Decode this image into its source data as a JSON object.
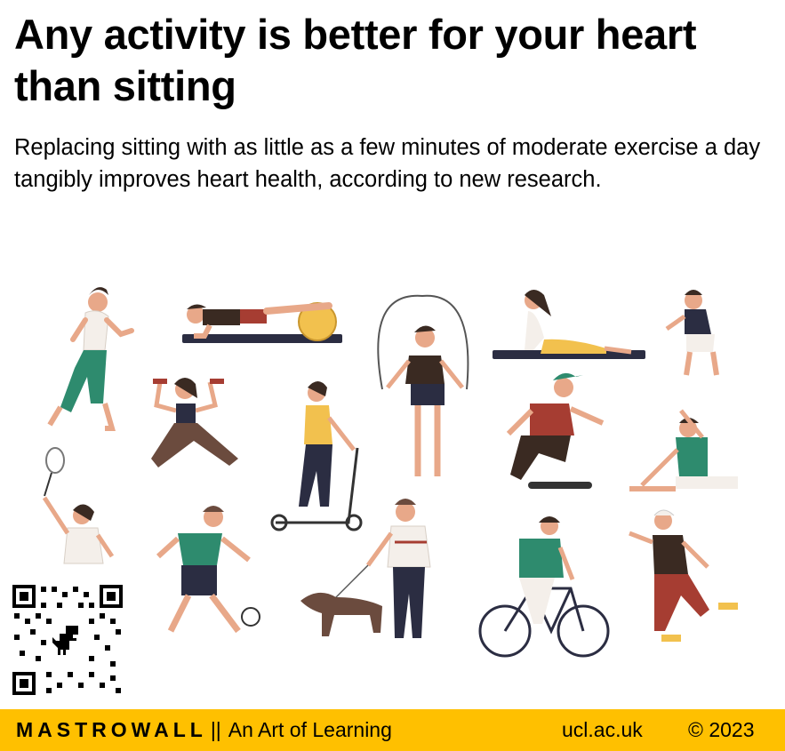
{
  "headline": "Any activity is better for your heart than sitting",
  "subtext": "Replacing sitting with as little as a few minutes of moderate exercise a day tangibly improves heart health, according to new research.",
  "footer": {
    "brand": "MASTROWALL",
    "separator": "||",
    "tagline": "An Art of Learning",
    "site": "ucl.ac.uk",
    "copyright": "© 2023",
    "bar_color": "#FFC000"
  },
  "illustration": {
    "figures": [
      "runner",
      "plank",
      "jump-rope",
      "yoga-cobra",
      "squat",
      "lunge-dumbbells",
      "scooter",
      "skateboarder",
      "stretching",
      "badminton",
      "football",
      "dog-walker",
      "cyclist",
      "rollerblader"
    ],
    "colors": {
      "green": "#2E8B6E",
      "skin": "#E8A889",
      "hair": "#3A2A22",
      "dark": "#2B2D42",
      "yellow": "#F2C14E",
      "red": "#A63D32"
    }
  },
  "qr_code": {
    "icon": "dinosaur-icon"
  }
}
